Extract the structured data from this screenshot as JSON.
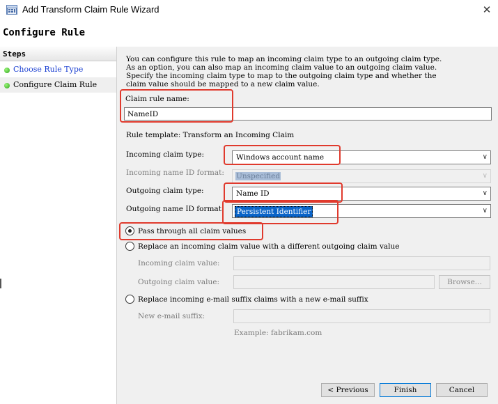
{
  "window": {
    "title": "Add Transform Claim Rule Wizard",
    "close_glyph": "✕"
  },
  "header": {
    "title": "Configure Rule"
  },
  "steps": {
    "title": "Steps",
    "items": [
      {
        "label": "Choose Rule Type"
      },
      {
        "label": "Configure Claim Rule"
      }
    ]
  },
  "description": [
    "You can configure this rule to map an incoming claim type to an outgoing claim type.",
    "As an option, you can also map an incoming claim value to an outgoing claim value.",
    "Specify the incoming claim type to map to the outgoing claim type and whether the",
    "claim value should be mapped to a new claim value."
  ],
  "form": {
    "claim_rule_name_label": "Claim rule name:",
    "claim_rule_name_value": "NameID",
    "rule_template": "Rule template: Transform an Incoming Claim",
    "incoming_claim_type_label": "Incoming claim type:",
    "incoming_claim_type_value": "Windows account name",
    "incoming_name_id_format_label": "Incoming name ID format:",
    "incoming_name_id_format_value": "Unspecified",
    "outgoing_claim_type_label": "Outgoing claim type:",
    "outgoing_claim_type_value": "Name ID",
    "outgoing_name_id_format_label": "Outgoing name ID format:",
    "outgoing_name_id_format_value": "Persistent Identifier",
    "pass_through_label": "Pass through all claim values",
    "replace_value_label": "Replace an incoming claim value with a different outgoing claim value",
    "incoming_claim_value_label": "Incoming claim value:",
    "outgoing_claim_value_label": "Outgoing claim value:",
    "browse_label": "Browse...",
    "replace_suffix_label": "Replace incoming e-mail suffix claims with a new e-mail suffix",
    "new_suffix_label": "New e-mail suffix:",
    "example_text": "Example: fabrikam.com",
    "selected_option": "pass-through"
  },
  "buttons": {
    "previous": "< Previous",
    "finish": "Finish",
    "cancel": "Cancel"
  },
  "colors": {
    "highlight": "#e03a2d",
    "selection": "#0a64c8",
    "link": "#1a3fd1"
  },
  "icons": {
    "app": "wizard-app-icon",
    "step_status": "green-dot-icon",
    "dropdown": "chevron-down-icon",
    "close": "close-icon"
  }
}
